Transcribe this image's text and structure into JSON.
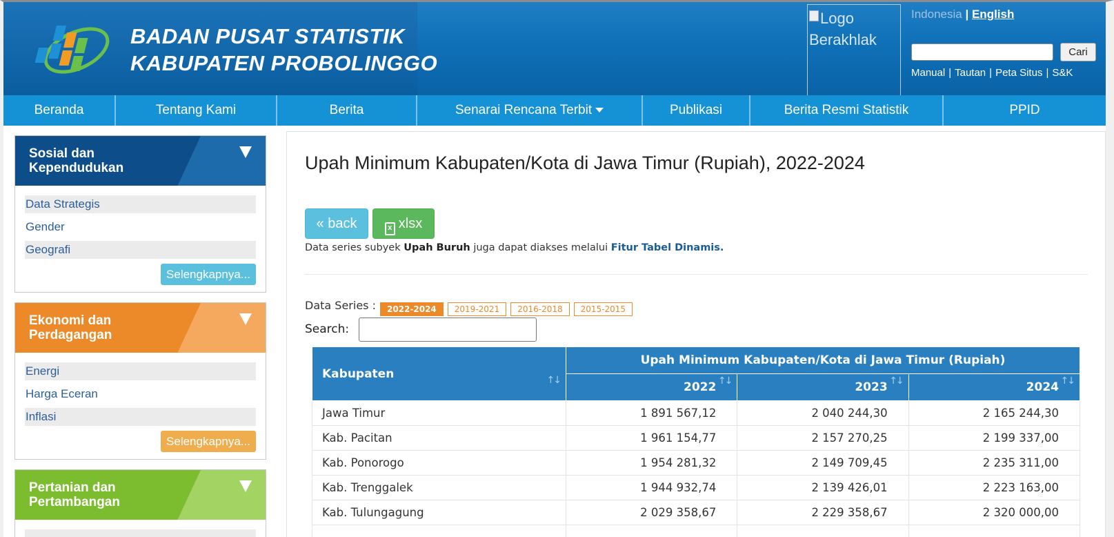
{
  "header": {
    "title_line1": "BADAN PUSAT STATISTIK",
    "title_line2": "KABUPATEN PROBOLINGGO",
    "berakhlak_alt": "Logo Berakhlak",
    "lang_id": "Indonesia",
    "lang_sep": "|",
    "lang_en": "English",
    "search_button": "Cari",
    "links": [
      "Manual",
      "Tautan",
      "Peta Situs",
      "S&K"
    ]
  },
  "nav": [
    {
      "label": "Beranda"
    },
    {
      "label": "Tentang Kami"
    },
    {
      "label": "Berita"
    },
    {
      "label": "Senarai Rencana Terbit",
      "dropdown": true
    },
    {
      "label": "Publikasi"
    },
    {
      "label": "Berita Resmi Statistik"
    },
    {
      "label": "PPID"
    }
  ],
  "sidebar": {
    "categories": [
      {
        "title_line1": "Sosial dan",
        "title_line2": "Kependudukan",
        "color": "#0c4d8a",
        "links": [
          "Data Strategis",
          "Gender",
          "Geografi"
        ],
        "more": "Selengkapnya...",
        "more_color": "#5bc0de"
      },
      {
        "title_line1": "Ekonomi dan",
        "title_line2": "Perdagangan",
        "color": "#ec8a2a",
        "links": [
          "Energi",
          "Harga Eceran",
          "Inflasi"
        ],
        "more": "Selengkapnya...",
        "more_color": "#f0ad4e"
      },
      {
        "title_line1": "Pertanian dan",
        "title_line2": "Pertambangan",
        "color": "#7cbd2f"
      }
    ]
  },
  "main": {
    "title": "Upah Minimum Kabupaten/Kota di Jawa Timur (Rupiah), 2022-2024",
    "back_label": "« back",
    "xlsx_label": "xlsx",
    "note_prefix": "Data series subyek",
    "note_subject": "Upah Buruh",
    "note_mid": "juga dapat diakses melalui",
    "note_link": "Fitur Tabel Dinamis.",
    "data_series_label": "Data Series :",
    "data_series": [
      "2022-2024",
      "2019-2021",
      "2016-2018",
      "2015-2015"
    ],
    "data_series_active": "2022-2024",
    "search_label": "Search:"
  },
  "table": {
    "col_kabupaten": "Kabupaten",
    "group_header": "Upah Minimum Kabupaten/Kota di Jawa Timur (Rupiah)",
    "years": [
      "2022",
      "2023",
      "2024"
    ],
    "rows": [
      {
        "name": "Jawa Timur",
        "values": [
          "1 891 567,12",
          "2 040 244,30",
          "2 165 244,30"
        ]
      },
      {
        "name": "Kab. Pacitan",
        "values": [
          "1 961 154,77",
          "2 157 270,25",
          "2 199 337,00"
        ]
      },
      {
        "name": "Kab. Ponorogo",
        "values": [
          "1 954 281,32",
          "2 149 709,45",
          "2 235 311,00"
        ]
      },
      {
        "name": "Kab. Trenggalek",
        "values": [
          "1 944 932,74",
          "2 139 426,01",
          "2 223 163,00"
        ]
      },
      {
        "name": "Kab. Tulungagung",
        "values": [
          "2 029 358,67",
          "2 229 358,67",
          "2 320 000,00"
        ]
      }
    ]
  }
}
